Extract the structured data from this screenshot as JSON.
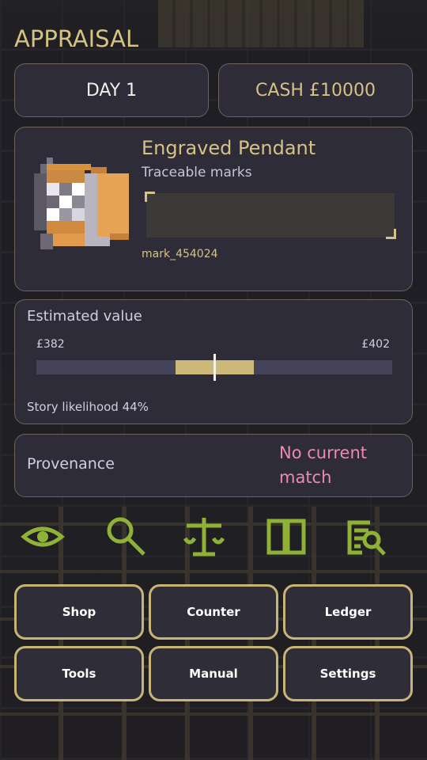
{
  "header": {
    "title": "APPRAISAL"
  },
  "stats": {
    "day": "DAY 1",
    "cash": "CASH £10000"
  },
  "item": {
    "name": "Engraved Pendant",
    "subtitle": "Traceable marks",
    "mark_id": "mark_454024",
    "icon": "pendant-pixel-icon"
  },
  "estimate": {
    "label": "Estimated value",
    "range_min": "£382",
    "range_max": "£402",
    "band_start_fraction": 0.39,
    "band_end_fraction": 0.61,
    "needle_fraction": 0.5,
    "likelihood": "Story likelihood 44%"
  },
  "provenance": {
    "label": "Provenance",
    "value": "No current match"
  },
  "tools": [
    {
      "icon": "eye-icon"
    },
    {
      "icon": "magnifier-icon"
    },
    {
      "icon": "scales-icon"
    },
    {
      "icon": "book-icon"
    },
    {
      "icon": "document-search-icon"
    }
  ],
  "buttons": {
    "shop": "Shop",
    "counter": "Counter",
    "ledger": "Ledger",
    "tools": "Tools",
    "manual": "Manual",
    "settings": "Settings"
  },
  "colors": {
    "accent_gold": "#d6c283",
    "icon_green": "#8fb236",
    "warning_pink": "#ec89b5",
    "panel_bg": "#2d2c38"
  }
}
